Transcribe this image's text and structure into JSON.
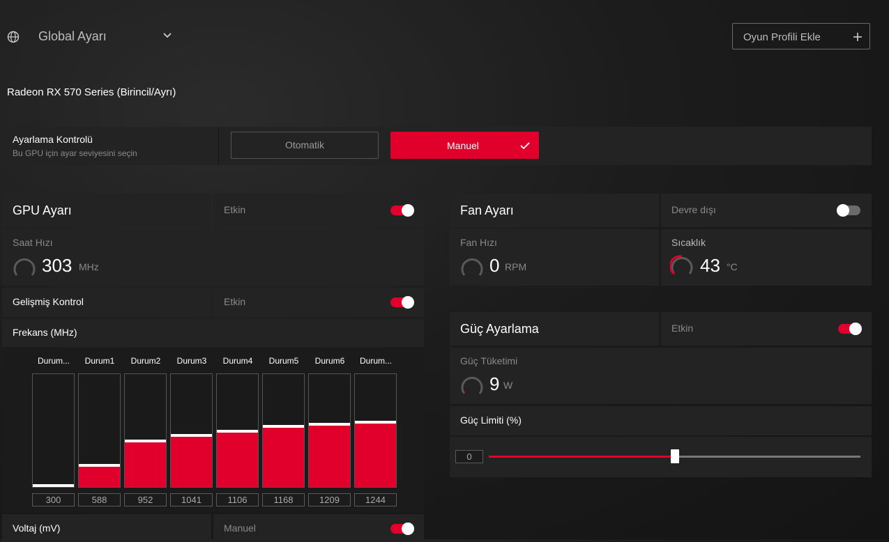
{
  "header": {
    "profile_selector": "Global Ayarı",
    "add_profile_label": "Oyun Profili Ekle"
  },
  "device_name": "Radeon RX 570 Series (Birincil/Ayrı)",
  "tuning_control": {
    "title": "Ayarlama Kontrolü",
    "subtitle": "Bu GPU için ayar seviyesini seçin",
    "auto_label": "Otomatik",
    "manual_label": "Manuel",
    "selected": "Manuel"
  },
  "gpu_tuning": {
    "title": "GPU Ayarı",
    "status": "Etkin",
    "enabled": true,
    "clock_label": "Saat Hızı",
    "clock_value": "303",
    "clock_unit": "MHz",
    "advanced_label": "Gelişmiş Kontrol",
    "advanced_status": "Etkin",
    "advanced_enabled": true,
    "freq_title": "Frekans (MHz)",
    "states": [
      {
        "label": "Durum...",
        "value": "300",
        "level": 0.0
      },
      {
        "label": "Durum1",
        "value": "588",
        "level": 0.18
      },
      {
        "label": "Durum2",
        "value": "952",
        "level": 0.4
      },
      {
        "label": "Durum3",
        "value": "1041",
        "level": 0.45
      },
      {
        "label": "Durum4",
        "value": "1106",
        "level": 0.49
      },
      {
        "label": "Durum5",
        "value": "1168",
        "level": 0.53
      },
      {
        "label": "Durum6",
        "value": "1209",
        "level": 0.55
      },
      {
        "label": "Durum...",
        "value": "1244",
        "level": 0.57
      }
    ],
    "voltage_label": "Voltaj (mV)",
    "voltage_status": "Manuel",
    "voltage_enabled": true
  },
  "fan_tuning": {
    "title": "Fan Ayarı",
    "status": "Devre dışı",
    "enabled": false,
    "fan_speed_label": "Fan Hızı",
    "fan_speed_value": "0",
    "fan_speed_unit": "RPM",
    "temp_label": "Sıcaklık",
    "temp_value": "43",
    "temp_unit": "°C",
    "temp_level": 0.43
  },
  "power_tuning": {
    "title": "Güç Ayarlama",
    "status": "Etkin",
    "enabled": true,
    "consumption_label": "Güç Tüketimi",
    "consumption_value": "9",
    "consumption_unit": "W",
    "limit_label": "Güç Limiti (%)",
    "limit_value": "0",
    "limit_slider_fraction": 0.5
  },
  "colors": {
    "accent": "#e0002b",
    "panel": "#232323",
    "muted": "#8a8a8a"
  }
}
